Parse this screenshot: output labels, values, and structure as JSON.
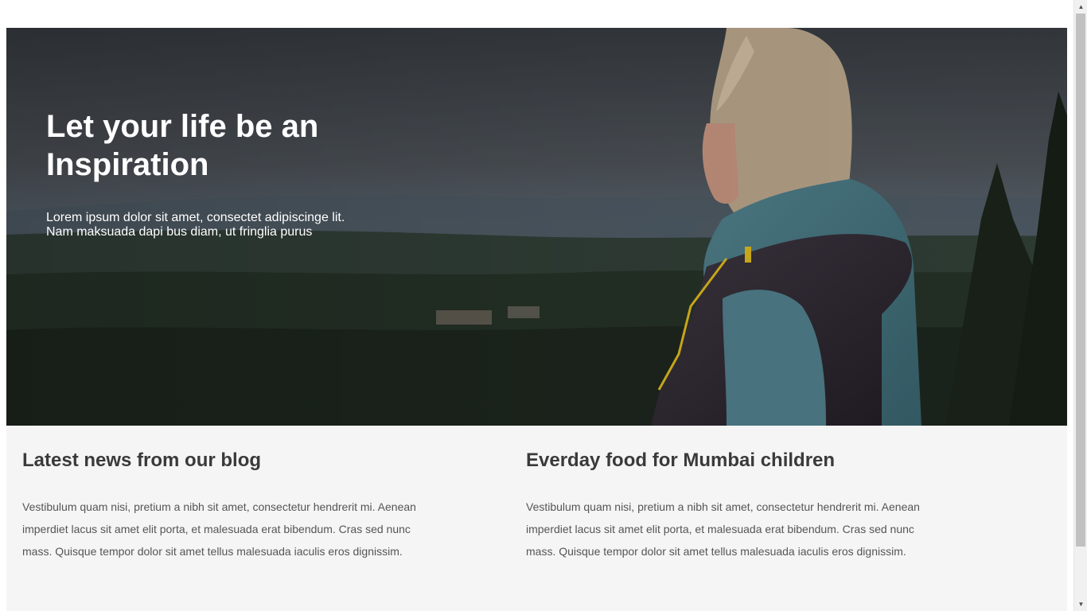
{
  "hero": {
    "title_lines": [
      "Let your life be an",
      "Inspiration"
    ],
    "subtitle_lines": [
      "Lorem ipsum dolor sit amet, consectet adipiscinge lit.",
      "Nam maksuada dapi bus diam, ut fringlia purus"
    ]
  },
  "columns": [
    {
      "heading": "Latest news from our blog",
      "body_lines": [
        "Vestibulum quam nisi, pretium a nibh sit amet, consectetur hendrerit mi. Aenean",
        "imperdiet lacus sit amet elit porta, et malesuada erat bibendum. Cras sed nunc",
        "mass. Quisque tempor dolor sit amet tellus malesuada iaculis eros dignissim."
      ]
    },
    {
      "heading": "Everday food for Mumbai children",
      "body_lines": [
        "Vestibulum quam nisi, pretium a nibh sit amet, consectetur hendrerit mi. Aenean",
        "imperdiet lacus sit amet elit porta, et malesuada erat bibendum. Cras sed nunc",
        "mass. Quisque tempor dolor sit amet tellus malesuada iaculis eros dignissim."
      ]
    }
  ],
  "scrollbar": {
    "up_icon": "▲",
    "down_icon": "▼"
  },
  "colors": {
    "page_background": "#f5f5f5",
    "heading_text": "#3a3a3a",
    "body_text": "#555555",
    "hero_text": "#ffffff"
  }
}
